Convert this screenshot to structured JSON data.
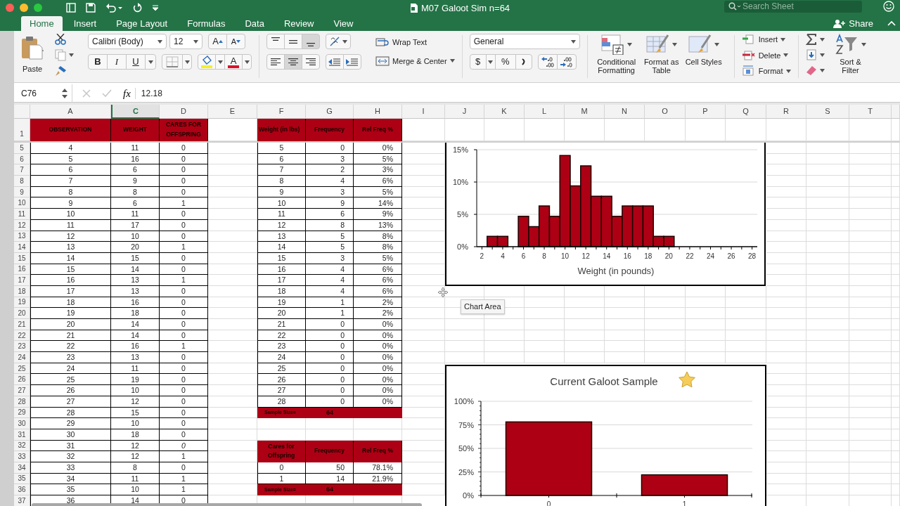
{
  "window": {
    "title": "M07 Galoot Sim n=64",
    "search_placeholder": "Search Sheet",
    "share": "Share"
  },
  "tabs": [
    {
      "label": "Home",
      "selected": true
    },
    {
      "label": "Insert",
      "selected": false
    },
    {
      "label": "Page Layout",
      "selected": false
    },
    {
      "label": "Formulas",
      "selected": false
    },
    {
      "label": "Data",
      "selected": false
    },
    {
      "label": "Review",
      "selected": false
    },
    {
      "label": "View",
      "selected": false
    }
  ],
  "ribbon": {
    "paste": "Paste",
    "font_name": "Calibri (Body)",
    "font_size": "12",
    "grow_font": "A",
    "shrink_font": "A",
    "bold": "B",
    "italic": "I",
    "underline": "U",
    "font_color": "A",
    "valign": [
      {
        "kind": "top",
        "selected": false
      },
      {
        "kind": "middle",
        "selected": false
      },
      {
        "kind": "bottom",
        "selected": true
      }
    ],
    "halign": [
      {
        "kind": "left",
        "selected": false
      },
      {
        "kind": "center",
        "selected": true
      },
      {
        "kind": "right",
        "selected": false
      }
    ],
    "wrap_text": "Wrap Text",
    "merge_center": "Merge & Center",
    "number_format": "General",
    "currency": "$",
    "percent": "%",
    "styles": [
      "Conditional Formatting",
      "Format as Table",
      "Cell Styles"
    ],
    "cells": [
      "Insert",
      "Delete",
      "Format"
    ],
    "sort_filter": "Sort & Filter"
  },
  "formula_bar": {
    "name_box": "C76",
    "fx": "fx",
    "value": "12.18"
  },
  "sheet": {
    "columns": [
      {
        "label": "A",
        "selected": false
      },
      {
        "label": "C",
        "selected": true
      },
      {
        "label": "D",
        "selected": false
      },
      {
        "label": "E",
        "selected": false
      },
      {
        "label": "F",
        "selected": false
      },
      {
        "label": "G",
        "selected": false
      },
      {
        "label": "H",
        "selected": false
      },
      {
        "label": "I",
        "selected": false
      },
      {
        "label": "J",
        "selected": false
      },
      {
        "label": "K",
        "selected": false
      },
      {
        "label": "L",
        "selected": false
      },
      {
        "label": "M",
        "selected": false
      },
      {
        "label": "N",
        "selected": false
      },
      {
        "label": "O",
        "selected": false
      },
      {
        "label": "P",
        "selected": false
      },
      {
        "label": "Q",
        "selected": false
      },
      {
        "label": "R",
        "selected": false
      },
      {
        "label": "S",
        "selected": false
      },
      {
        "label": "T",
        "selected": false
      }
    ],
    "header_row": "1",
    "headers": {
      "a": "OBSERVATION",
      "c": "WEIGHT",
      "d": "CARES FOR OFFSPRING",
      "f": "Weight (in lbs)",
      "g": "Frequency",
      "h": "Rel Freq %"
    },
    "rows": [
      {
        "n": "5",
        "a": "4",
        "c": "11",
        "d": "0",
        "right": {
          "kind": "data",
          "f": "5",
          "g": "0",
          "h": "0%"
        }
      },
      {
        "n": "6",
        "a": "5",
        "c": "16",
        "d": "0",
        "right": {
          "kind": "data",
          "f": "6",
          "g": "3",
          "h": "5%"
        }
      },
      {
        "n": "7",
        "a": "6",
        "c": "6",
        "d": "0",
        "right": {
          "kind": "data",
          "f": "7",
          "g": "2",
          "h": "3%"
        }
      },
      {
        "n": "8",
        "a": "7",
        "c": "9",
        "d": "0",
        "right": {
          "kind": "data",
          "f": "8",
          "g": "4",
          "h": "6%"
        }
      },
      {
        "n": "9",
        "a": "8",
        "c": "8",
        "d": "0",
        "right": {
          "kind": "data",
          "f": "9",
          "g": "3",
          "h": "5%"
        }
      },
      {
        "n": "10",
        "a": "9",
        "c": "6",
        "d": "1",
        "right": {
          "kind": "data",
          "f": "10",
          "g": "9",
          "h": "14%"
        }
      },
      {
        "n": "11",
        "a": "10",
        "c": "11",
        "d": "0",
        "right": {
          "kind": "data",
          "f": "11",
          "g": "6",
          "h": "9%"
        }
      },
      {
        "n": "12",
        "a": "11",
        "c": "17",
        "d": "0",
        "right": {
          "kind": "data",
          "f": "12",
          "g": "8",
          "h": "13%"
        }
      },
      {
        "n": "13",
        "a": "12",
        "c": "10",
        "d": "0",
        "right": {
          "kind": "data",
          "f": "13",
          "g": "5",
          "h": "8%"
        }
      },
      {
        "n": "14",
        "a": "13",
        "c": "20",
        "d": "1",
        "right": {
          "kind": "data",
          "f": "14",
          "g": "5",
          "h": "8%"
        }
      },
      {
        "n": "15",
        "a": "14",
        "c": "15",
        "d": "0",
        "right": {
          "kind": "data",
          "f": "15",
          "g": "3",
          "h": "5%"
        }
      },
      {
        "n": "16",
        "a": "15",
        "c": "14",
        "d": "0",
        "right": {
          "kind": "data",
          "f": "16",
          "g": "4",
          "h": "6%"
        }
      },
      {
        "n": "17",
        "a": "16",
        "c": "13",
        "d": "1",
        "right": {
          "kind": "data",
          "f": "17",
          "g": "4",
          "h": "6%"
        }
      },
      {
        "n": "18",
        "a": "17",
        "c": "13",
        "d": "0",
        "right": {
          "kind": "data",
          "f": "18",
          "g": "4",
          "h": "6%"
        }
      },
      {
        "n": "19",
        "a": "18",
        "c": "16",
        "d": "0",
        "right": {
          "kind": "data",
          "f": "19",
          "g": "1",
          "h": "2%"
        }
      },
      {
        "n": "20",
        "a": "19",
        "c": "18",
        "d": "0",
        "right": {
          "kind": "data",
          "f": "20",
          "g": "1",
          "h": "2%"
        }
      },
      {
        "n": "21",
        "a": "20",
        "c": "14",
        "d": "0",
        "right": {
          "kind": "data",
          "f": "21",
          "g": "0",
          "h": "0%"
        }
      },
      {
        "n": "22",
        "a": "21",
        "c": "14",
        "d": "0",
        "right": {
          "kind": "data",
          "f": "22",
          "g": "0",
          "h": "0%"
        }
      },
      {
        "n": "23",
        "a": "22",
        "c": "16",
        "d": "1",
        "right": {
          "kind": "data",
          "f": "23",
          "g": "0",
          "h": "0%"
        }
      },
      {
        "n": "24",
        "a": "23",
        "c": "13",
        "d": "0",
        "right": {
          "kind": "data",
          "f": "24",
          "g": "0",
          "h": "0%"
        }
      },
      {
        "n": "25",
        "a": "24",
        "c": "11",
        "d": "0",
        "right": {
          "kind": "data",
          "f": "25",
          "g": "0",
          "h": "0%"
        }
      },
      {
        "n": "26",
        "a": "25",
        "c": "19",
        "d": "0",
        "right": {
          "kind": "data",
          "f": "26",
          "g": "0",
          "h": "0%"
        }
      },
      {
        "n": "27",
        "a": "26",
        "c": "10",
        "d": "0",
        "right": {
          "kind": "data",
          "f": "27",
          "g": "0",
          "h": "0%"
        }
      },
      {
        "n": "28",
        "a": "27",
        "c": "12",
        "d": "0",
        "right": {
          "kind": "data",
          "f": "28",
          "g": "0",
          "h": "0%"
        }
      },
      {
        "n": "29",
        "a": "28",
        "c": "15",
        "d": "0",
        "right": {
          "kind": "sample",
          "label": "Sample Size=",
          "value": "64"
        }
      },
      {
        "n": "30",
        "a": "29",
        "c": "10",
        "d": "0"
      },
      {
        "n": "31",
        "a": "30",
        "c": "18",
        "d": "0"
      },
      {
        "n": "32",
        "a": "31",
        "c": "12",
        "d": "0",
        "d_italic": true,
        "right": {
          "kind": "header",
          "f": "Cares for Offspring",
          "g": "Frequency",
          "h": "Rel Freq %"
        }
      },
      {
        "n": "33",
        "a": "32",
        "c": "12",
        "d": "1"
      },
      {
        "n": "34",
        "a": "33",
        "c": "8",
        "d": "0",
        "right": {
          "kind": "data",
          "f": "0",
          "g": "50",
          "h": "78.1%"
        }
      },
      {
        "n": "35",
        "a": "34",
        "c": "11",
        "d": "1",
        "right": {
          "kind": "data",
          "f": "1",
          "g": "14",
          "h": "21.9%"
        }
      },
      {
        "n": "36",
        "a": "35",
        "c": "10",
        "d": "1",
        "right": {
          "kind": "sample",
          "label": "Sample Size=",
          "value": "64"
        }
      },
      {
        "n": "37",
        "a": "36",
        "c": "14",
        "d": "0"
      }
    ]
  },
  "charts": [
    {
      "chart_data": {
        "type": "bar",
        "xlabel": "Weight (in pounds)",
        "x": [
          2,
          3,
          4,
          5,
          6,
          7,
          8,
          9,
          10,
          11,
          12,
          13,
          14,
          15,
          16,
          17,
          18,
          19,
          20,
          21,
          22,
          23,
          24,
          25,
          26,
          27,
          28
        ],
        "values": [
          0,
          0.016,
          0.016,
          0,
          0.047,
          0.031,
          0.063,
          0.047,
          0.141,
          0.094,
          0.125,
          0.078,
          0.078,
          0.047,
          0.063,
          0.063,
          0.063,
          0.016,
          0.016,
          0,
          0,
          0,
          0,
          0,
          0,
          0,
          0
        ],
        "grid": true,
        "xlim": [
          1.5,
          28.5
        ],
        "xticks": [
          2,
          4,
          6,
          8,
          10,
          12,
          14,
          16,
          18,
          20,
          22,
          24,
          26,
          28
        ],
        "ylim": [
          0,
          0.15
        ],
        "yticks": [
          {
            "value": 0,
            "label": "0%"
          },
          {
            "value": 0.05,
            "label": "5%"
          },
          {
            "value": 0.1,
            "label": "10%"
          },
          {
            "value": 0.15,
            "label": "15%"
          }
        ]
      }
    },
    {
      "chart_data": {
        "type": "bar",
        "title": "Current Galoot Sample",
        "grid": true,
        "categories": [
          "0",
          "1"
        ],
        "values": [
          0.781,
          0.219
        ],
        "ylim": [
          0,
          1
        ],
        "yticks": [
          {
            "value": 0,
            "label": "0%"
          },
          {
            "value": 0.25,
            "label": "25%"
          },
          {
            "value": 0.5,
            "label": "50%"
          },
          {
            "value": 0.75,
            "label": "75%"
          },
          {
            "value": 1,
            "label": "100%"
          }
        ]
      }
    }
  ],
  "tooltip": "Chart Area"
}
